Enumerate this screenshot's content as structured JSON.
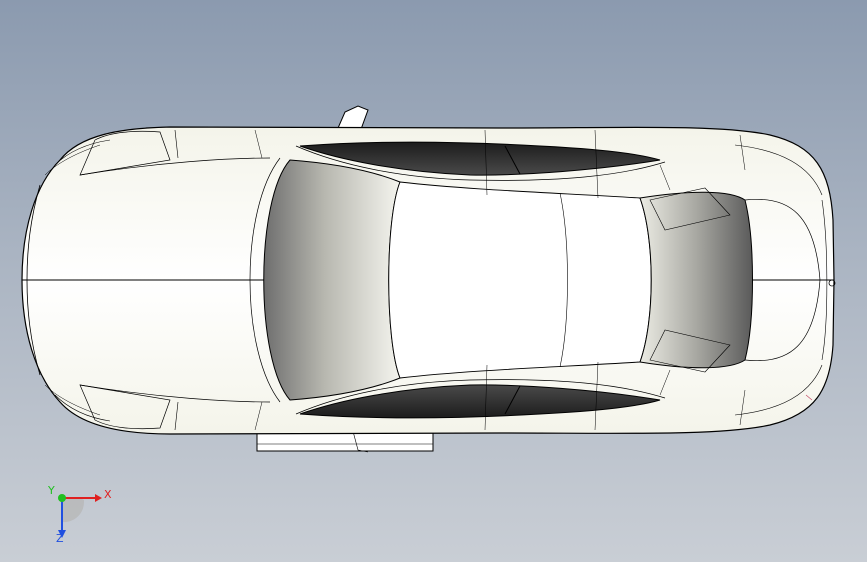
{
  "viewport": {
    "background_top": "#8b9aaf",
    "background_bottom": "#c9ced5"
  },
  "model": {
    "icon": "car-top-view-icon",
    "body_color": "#ffffff",
    "edge_color": "#000000",
    "glass_color": "#2b2b2b"
  },
  "triad": {
    "x_label": "X",
    "y_label": "Y",
    "z_label": "Z",
    "x_color": "#e02020",
    "y_color": "#20c020",
    "z_color": "#2050e0"
  }
}
